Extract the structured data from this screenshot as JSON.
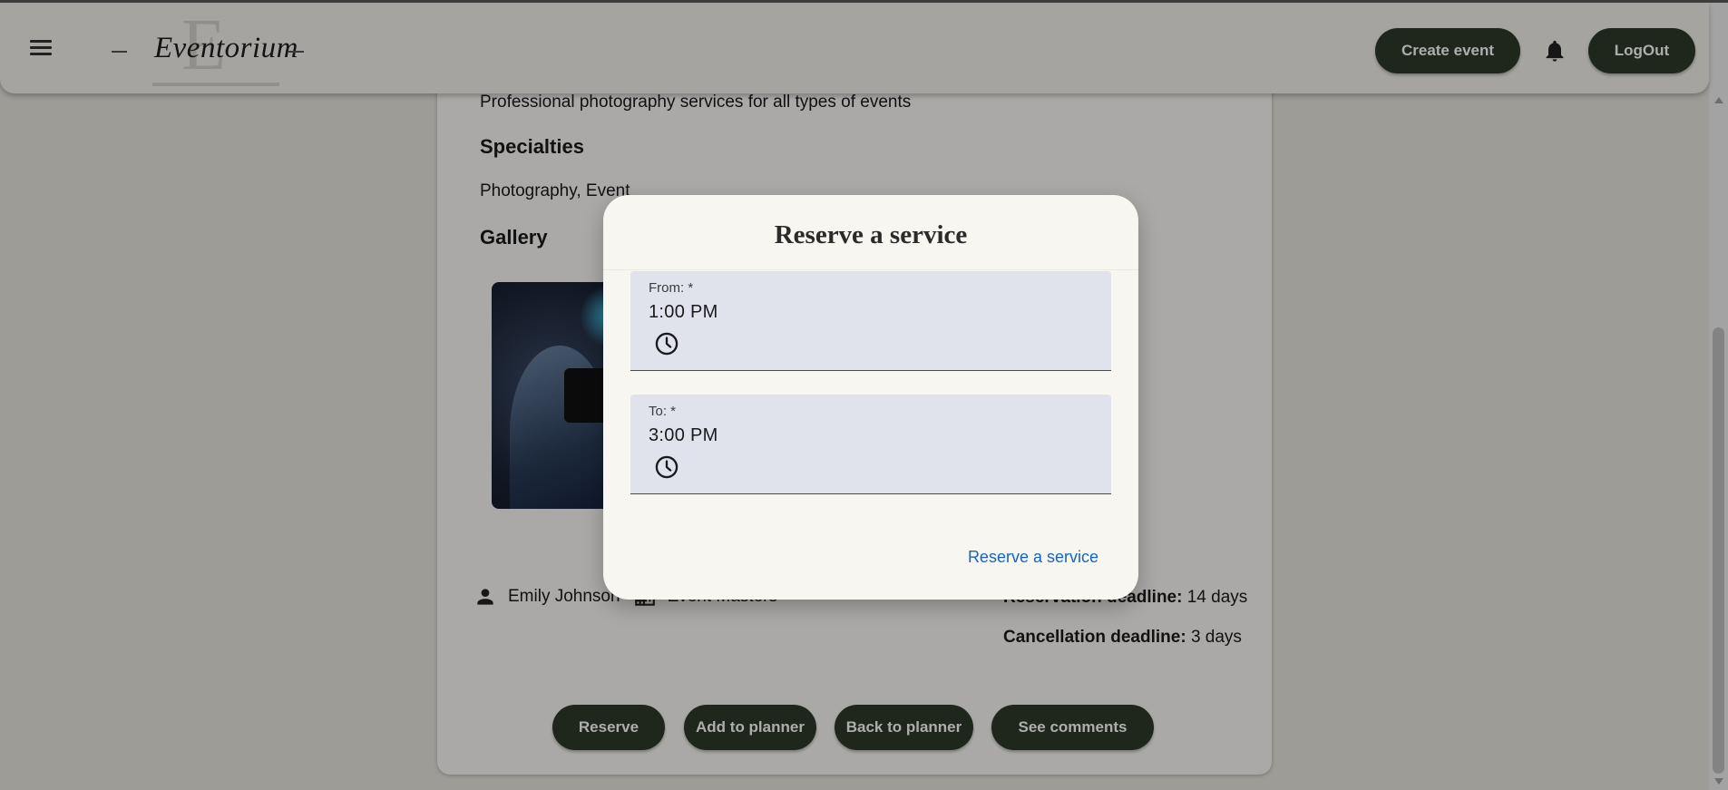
{
  "app": {
    "logo_text": "Eventorium",
    "logo_letter": "E"
  },
  "header": {
    "menu_icon": "hamburger-menu-icon",
    "create_event_label": "Create event",
    "notification_icon": "bell-icon",
    "logout_label": "LogOut"
  },
  "service": {
    "description": "Professional photography services for all types of events",
    "specialties_title": "Specialties",
    "specialties": "Photography, Event",
    "gallery_title": "Gallery",
    "provider_name": "Emily Johnson",
    "company_name": "Event Masters",
    "reservation_deadline_label": "Reservation deadline:",
    "reservation_deadline_value": "14 days",
    "cancellation_deadline_label": "Cancellation deadline:",
    "cancellation_deadline_value": "3 days"
  },
  "actions": {
    "reserve": "Reserve",
    "add_to_planner": "Add to planner",
    "back_to_planner": "Back to planner",
    "see_comments": "See comments"
  },
  "dialog": {
    "title": "Reserve a service",
    "from_label": "From: *",
    "from_value": "1:00 PM",
    "to_label": "To: *",
    "to_value": "3:00 PM",
    "submit_label": "Reserve a service"
  },
  "colors": {
    "primary_button": "#2e3a2c",
    "link": "#1565c0",
    "field_bg": "#e1e3ec",
    "dialog_bg": "#f7f6f1"
  }
}
